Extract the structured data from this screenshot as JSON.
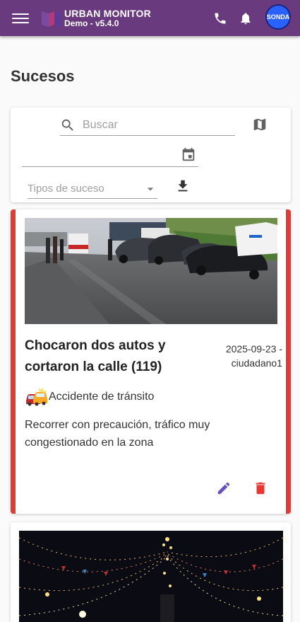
{
  "app": {
    "brand_name": "URBAN MONITOR",
    "version": "Demo - v5.4.0",
    "avatar_text": "SONDA",
    "accent_color": "#6a3a7e",
    "icons": [
      "menu-icon",
      "phone-icon",
      "bell-icon"
    ]
  },
  "page": {
    "title": "Sucesos"
  },
  "filters": {
    "search_placeholder": "Buscar",
    "date_value": "",
    "type_placeholder": "Tipos de suceso",
    "icons": [
      "search-icon",
      "map-icon",
      "calendar-icon",
      "chevron-down-icon",
      "download-icon"
    ]
  },
  "events": [
    {
      "title": "Chocaron dos autos y cortaron la calle (119)",
      "date": "2025-09-23 -",
      "user": "ciudadano1",
      "type": "Accidente de tránsito",
      "description": "Recorrer con precaución, tráfico muy congestionado en la zona",
      "status_color": "#e53935",
      "icons": [
        "car-crash-icon",
        "edit-icon",
        "delete-icon"
      ]
    },
    {
      "title": "",
      "icons": []
    }
  ]
}
